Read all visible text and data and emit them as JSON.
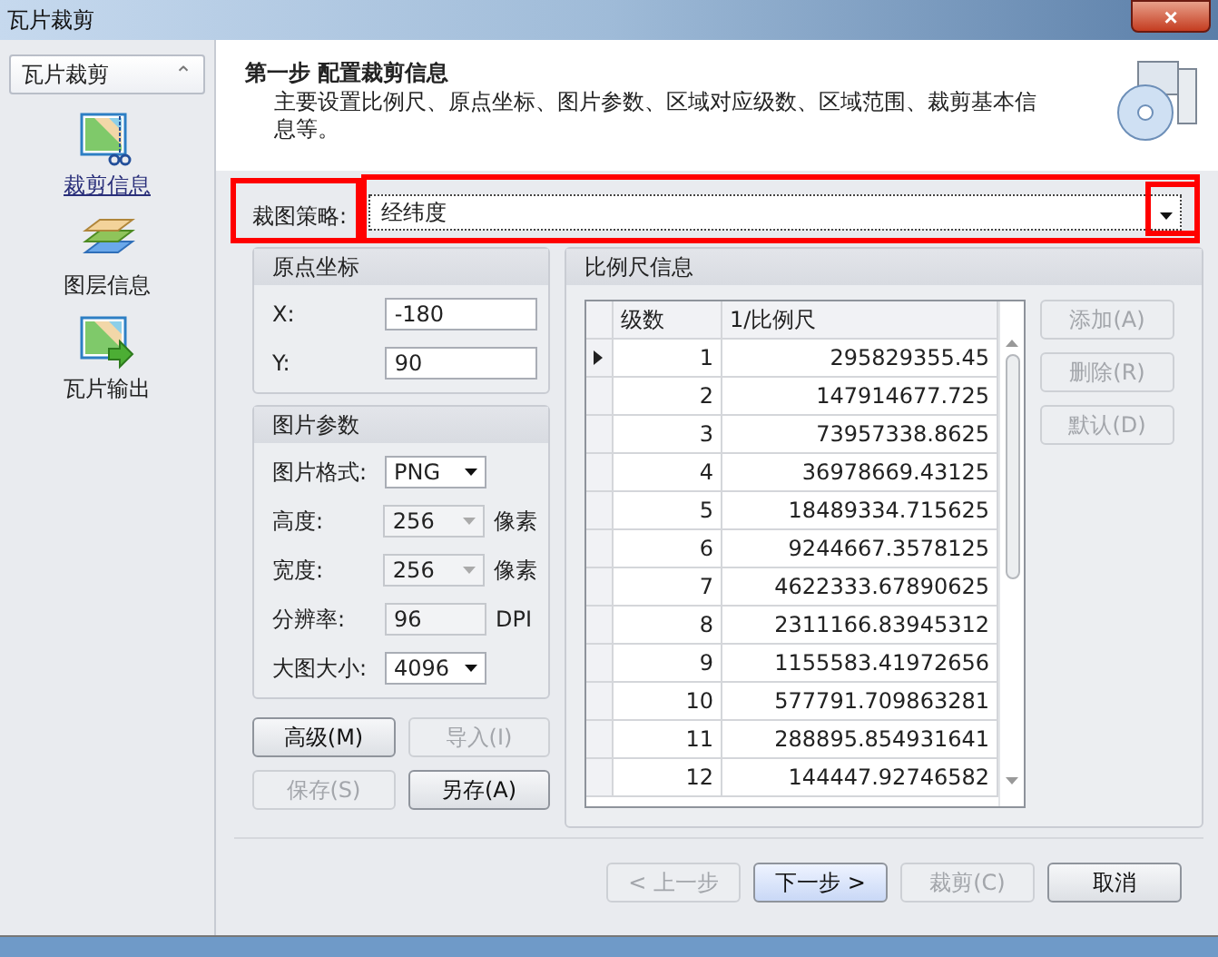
{
  "window": {
    "title": "瓦片裁剪",
    "close": "×"
  },
  "sidebar": {
    "header": "瓦片裁剪",
    "collapse": "⌃",
    "items": [
      {
        "label": "裁剪信息",
        "selected": true
      },
      {
        "label": "图层信息",
        "selected": false
      },
      {
        "label": "瓦片输出",
        "selected": false
      }
    ]
  },
  "header": {
    "title": "第一步 配置裁剪信息",
    "description": "主要设置比例尺、原点坐标、图片参数、区域对应级数、区域范围、裁剪基本信息等。"
  },
  "strategy": {
    "label": "裁图策略:",
    "value": "经纬度",
    "highlighted": true
  },
  "origin": {
    "title": "原点坐标",
    "fields": [
      {
        "label": "X:",
        "value": "-180"
      },
      {
        "label": "Y:",
        "value": "90"
      }
    ]
  },
  "image_params": {
    "title": "图片参数",
    "fields": [
      {
        "label": "图片格式:",
        "value": "PNG",
        "kind": "dropdown",
        "disabled": false
      },
      {
        "label": "高度:",
        "value": "256",
        "kind": "dropdown",
        "disabled": true,
        "unit": "像素"
      },
      {
        "label": "宽度:",
        "value": "256",
        "kind": "dropdown",
        "disabled": true,
        "unit": "像素"
      },
      {
        "label": "分辨率:",
        "value": "96",
        "kind": "text",
        "disabled": true,
        "unit": "DPI"
      },
      {
        "label": "大图大小:",
        "value": "4096",
        "kind": "dropdown",
        "disabled": false
      }
    ]
  },
  "left_buttons": [
    {
      "label": "高级(M)",
      "disabled": false
    },
    {
      "label": "导入(I)",
      "disabled": true
    },
    {
      "label": "保存(S)",
      "disabled": true
    },
    {
      "label": "另存(A)",
      "disabled": false
    }
  ],
  "scale": {
    "title": "比例尺信息",
    "columns": [
      "级数",
      "1/比例尺"
    ],
    "rows": [
      {
        "level": "1",
        "scale": "295829355.45",
        "selected": true
      },
      {
        "level": "2",
        "scale": "147914677.725",
        "selected": false
      },
      {
        "level": "3",
        "scale": "73957338.8625",
        "selected": false
      },
      {
        "level": "4",
        "scale": "36978669.43125",
        "selected": false
      },
      {
        "level": "5",
        "scale": "18489334.715625",
        "selected": false
      },
      {
        "level": "6",
        "scale": "9244667.3578125",
        "selected": false
      },
      {
        "level": "7",
        "scale": "4622333.67890625",
        "selected": false
      },
      {
        "level": "8",
        "scale": "2311166.83945312",
        "selected": false
      },
      {
        "level": "9",
        "scale": "1155583.41972656",
        "selected": false
      },
      {
        "level": "10",
        "scale": "577791.709863281",
        "selected": false
      },
      {
        "level": "11",
        "scale": "288895.854931641",
        "selected": false
      },
      {
        "level": "12",
        "scale": "144447.92746582",
        "selected": false
      }
    ],
    "buttons": [
      {
        "label": "添加(A)",
        "disabled": true
      },
      {
        "label": "删除(R)",
        "disabled": true
      },
      {
        "label": "默认(D)",
        "disabled": true
      }
    ]
  },
  "footer_buttons": [
    {
      "label": "< 上一步",
      "primary": false,
      "enabled": false
    },
    {
      "label": "下一步 >",
      "primary": true,
      "enabled": true
    },
    {
      "label": "裁剪(C)",
      "primary": false,
      "enabled": false
    },
    {
      "label": "取消",
      "primary": false,
      "enabled": true
    }
  ]
}
